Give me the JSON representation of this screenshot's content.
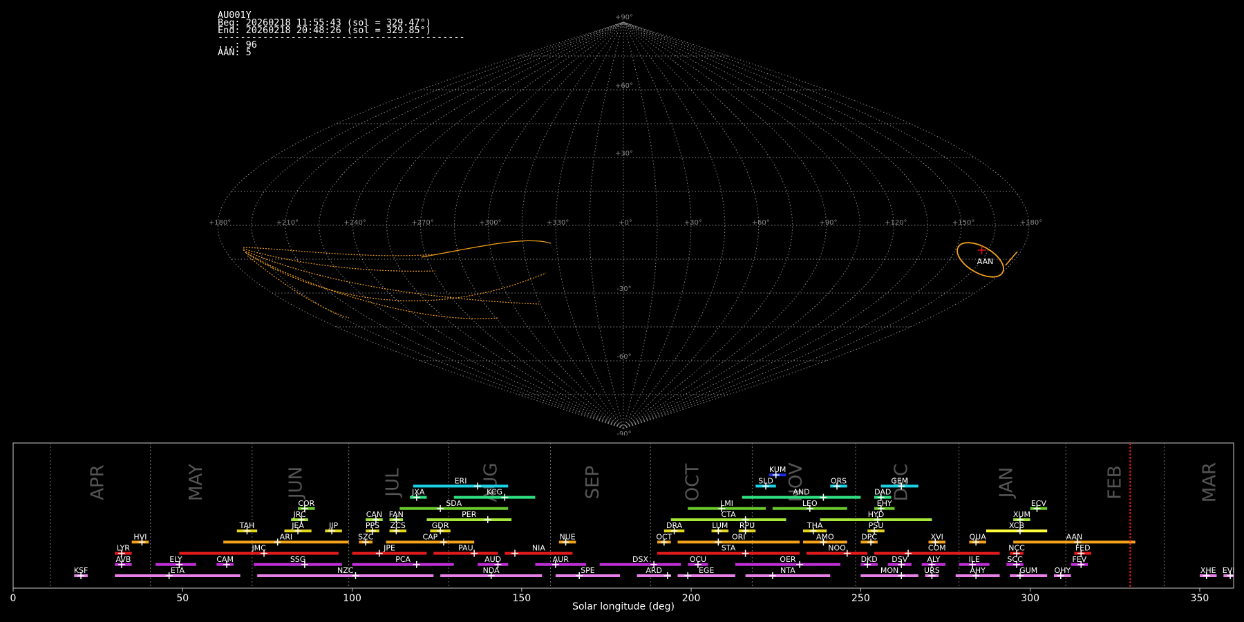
{
  "info": {
    "station": "AU001Y",
    "begin": "Beg: 20260218 11:55:43 (sol = 329.47°)",
    "end": "End: 20260218 20:48:26 (sol = 329.85°)",
    "separator": "--------------------------------------------",
    "sporadic": "...: 96",
    "shower_count": "AAN: 5"
  },
  "sky_map": {
    "projection": "sinusoidal",
    "lon_labels": [
      "+180°",
      "+150°",
      "+120°",
      "+90°",
      "+60°",
      "+30°",
      "+0°",
      "+330°",
      "+300°",
      "+270°",
      "+240°",
      "+210°",
      "+180°"
    ],
    "lat_labels": [
      {
        "lat": 90,
        "label": "+90°"
      },
      {
        "lat": 60,
        "label": "+60°"
      },
      {
        "lat": 30,
        "label": "+30°"
      },
      {
        "lat": -30,
        "label": "-30°"
      },
      {
        "lat": -60,
        "label": "-60°"
      },
      {
        "lat": -90,
        "label": "-90°"
      }
    ],
    "radiant": {
      "code": "AAN",
      "lon": 162,
      "lat": -11
    }
  },
  "chart_data": {
    "type": "timeline",
    "xlabel": "Solar longitude (deg)",
    "xlim": [
      0,
      360
    ],
    "xticks": [
      0,
      50,
      100,
      150,
      200,
      250,
      300,
      350
    ],
    "current_sol": 329.5,
    "month_boundaries": [
      11,
      40.5,
      70.5,
      99,
      128.5,
      158.5,
      188,
      218,
      248.5,
      279,
      310.5,
      339.5
    ],
    "months": [
      {
        "name": "APR",
        "sol": 25
      },
      {
        "name": "MAY",
        "sol": 54
      },
      {
        "name": "JUN",
        "sol": 83.5
      },
      {
        "name": "JUL",
        "sol": 112
      },
      {
        "name": "AUG",
        "sol": 141
      },
      {
        "name": "SEP",
        "sol": 171
      },
      {
        "name": "OCT",
        "sol": 200.5
      },
      {
        "name": "NOV",
        "sol": 231
      },
      {
        "name": "DEC",
        "sol": 262
      },
      {
        "name": "JAN",
        "sol": 293
      },
      {
        "name": "FEB",
        "sol": 325
      },
      {
        "name": "MAR",
        "sol": 353
      }
    ],
    "showers": [
      {
        "code": "KSF",
        "start": 18,
        "end": 22,
        "peak": 20,
        "row": 0,
        "color": "#e67ee6"
      },
      {
        "code": "ETA",
        "start": 30,
        "end": 67,
        "peak": 46,
        "row": 0,
        "color": "#e67ee6"
      },
      {
        "code": "NZC",
        "start": 72,
        "end": 124,
        "peak": 101,
        "row": 0,
        "color": "#e67ee6"
      },
      {
        "code": "NDA",
        "start": 126,
        "end": 156,
        "peak": 141,
        "row": 0,
        "color": "#e67ee6"
      },
      {
        "code": "SPE",
        "start": 160,
        "end": 179,
        "peak": 167,
        "row": 0,
        "color": "#e67ee6"
      },
      {
        "code": "ARD",
        "start": 184,
        "end": 194,
        "peak": 193,
        "row": 0,
        "color": "#e67ee6"
      },
      {
        "code": "EGE",
        "start": 196,
        "end": 213,
        "peak": 199,
        "row": 0,
        "color": "#e67ee6"
      },
      {
        "code": "NTA",
        "start": 216,
        "end": 241,
        "peak": 224,
        "row": 0,
        "color": "#e67ee6"
      },
      {
        "code": "MON",
        "start": 250,
        "end": 267,
        "peak": 262,
        "row": 0,
        "color": "#e67ee6"
      },
      {
        "code": "URS",
        "start": 269,
        "end": 273,
        "peak": 271,
        "row": 0,
        "color": "#e67ee6"
      },
      {
        "code": "AHY",
        "start": 278,
        "end": 291,
        "peak": 284,
        "row": 0,
        "color": "#e67ee6"
      },
      {
        "code": "GUM",
        "start": 294,
        "end": 305,
        "peak": 297,
        "row": 0,
        "color": "#e67ee6"
      },
      {
        "code": "OHY",
        "start": 307,
        "end": 312,
        "peak": 309,
        "row": 0,
        "color": "#e67ee6"
      },
      {
        "code": "XHE",
        "start": 350,
        "end": 355,
        "peak": 352,
        "row": 0,
        "color": "#e67ee6"
      },
      {
        "code": "EVI",
        "start": 357,
        "end": 362,
        "peak": 359,
        "row": 0,
        "color": "#e67ee6"
      },
      {
        "code": "AVB",
        "start": 30,
        "end": 35,
        "peak": 32,
        "row": 1,
        "color": "#c02fd6"
      },
      {
        "code": "ELY",
        "start": 42,
        "end": 54,
        "peak": 49,
        "row": 1,
        "color": "#c02fd6"
      },
      {
        "code": "CAM",
        "start": 60,
        "end": 65,
        "peak": 63,
        "row": 1,
        "color": "#c02fd6"
      },
      {
        "code": "SSG",
        "start": 71,
        "end": 97,
        "peak": 86,
        "row": 1,
        "color": "#c02fd6"
      },
      {
        "code": "PCA",
        "start": 100,
        "end": 130,
        "peak": 119,
        "row": 1,
        "color": "#c02fd6"
      },
      {
        "code": "AUD",
        "start": 137,
        "end": 146,
        "peak": 143,
        "row": 1,
        "color": "#c02fd6"
      },
      {
        "code": "AUR",
        "start": 154,
        "end": 169,
        "peak": 160,
        "row": 1,
        "color": "#c02fd6"
      },
      {
        "code": "DSX",
        "start": 173,
        "end": 197,
        "peak": 189,
        "row": 1,
        "color": "#c02fd6"
      },
      {
        "code": "OCU",
        "start": 199,
        "end": 205,
        "peak": 202,
        "row": 1,
        "color": "#c02fd6"
      },
      {
        "code": "OER",
        "start": 213,
        "end": 244,
        "peak": 232,
        "row": 1,
        "color": "#c02fd6"
      },
      {
        "code": "DKD",
        "start": 250,
        "end": 255,
        "peak": 252,
        "row": 1,
        "color": "#c02fd6"
      },
      {
        "code": "DSV",
        "start": 258,
        "end": 265,
        "peak": 262,
        "row": 1,
        "color": "#c02fd6"
      },
      {
        "code": "ALY",
        "start": 268,
        "end": 275,
        "peak": 271,
        "row": 1,
        "color": "#c02fd6"
      },
      {
        "code": "ILE",
        "start": 279,
        "end": 288,
        "peak": 283,
        "row": 1,
        "color": "#c02fd6"
      },
      {
        "code": "SCC",
        "start": 293,
        "end": 298,
        "peak": 296,
        "row": 1,
        "color": "#c02fd6"
      },
      {
        "code": "FEV",
        "start": 312,
        "end": 317,
        "peak": 315,
        "row": 1,
        "color": "#c02fd6"
      },
      {
        "code": "LYR",
        "start": 30,
        "end": 35,
        "peak": 32,
        "row": 2,
        "color": "#e31a1c"
      },
      {
        "code": "JMC",
        "start": 49,
        "end": 96,
        "peak": 74,
        "row": 2,
        "color": "#e31a1c"
      },
      {
        "code": "JPE",
        "start": 100,
        "end": 122,
        "peak": 108,
        "row": 2,
        "color": "#e31a1c"
      },
      {
        "code": "PAU",
        "start": 124,
        "end": 143,
        "peak": 136,
        "row": 2,
        "color": "#e31a1c"
      },
      {
        "code": "NIA",
        "start": 145,
        "end": 165,
        "peak": 148,
        "row": 2,
        "color": "#e31a1c"
      },
      {
        "code": "STA",
        "start": 190,
        "end": 232,
        "peak": 216,
        "row": 2,
        "color": "#e31a1c"
      },
      {
        "code": "NOO",
        "start": 234,
        "end": 252,
        "peak": 246,
        "row": 2,
        "color": "#e31a1c"
      },
      {
        "code": "COM",
        "start": 254,
        "end": 291,
        "peak": 264,
        "row": 2,
        "color": "#e31a1c"
      },
      {
        "code": "NCC",
        "start": 294,
        "end": 298,
        "peak": 296,
        "row": 2,
        "color": "#e31a1c"
      },
      {
        "code": "FED",
        "start": 313,
        "end": 318,
        "peak": 315,
        "row": 2,
        "color": "#e31a1c"
      },
      {
        "code": "HVI",
        "start": 35,
        "end": 40,
        "peak": 38,
        "row": 3,
        "color": "#f5a21b"
      },
      {
        "code": "ARI",
        "start": 62,
        "end": 99,
        "peak": 78,
        "row": 3,
        "color": "#f5a21b"
      },
      {
        "code": "SZC",
        "start": 102,
        "end": 106,
        "peak": 104,
        "row": 3,
        "color": "#f5a21b"
      },
      {
        "code": "CAP",
        "start": 110,
        "end": 136,
        "peak": 127,
        "row": 3,
        "color": "#f5a21b"
      },
      {
        "code": "NUE",
        "start": 161,
        "end": 166,
        "peak": 163,
        "row": 3,
        "color": "#f5a21b"
      },
      {
        "code": "OCT",
        "start": 190,
        "end": 194,
        "peak": 192,
        "row": 3,
        "color": "#f5a21b"
      },
      {
        "code": "ORI",
        "start": 196,
        "end": 232,
        "peak": 208,
        "row": 3,
        "color": "#f5a21b"
      },
      {
        "code": "AMO",
        "start": 233,
        "end": 246,
        "peak": 239,
        "row": 3,
        "color": "#f5a21b"
      },
      {
        "code": "DPC",
        "start": 250,
        "end": 255,
        "peak": 253,
        "row": 3,
        "color": "#f5a21b"
      },
      {
        "code": "XVI",
        "start": 270,
        "end": 275,
        "peak": 272,
        "row": 3,
        "color": "#f5a21b"
      },
      {
        "code": "QUA",
        "start": 282,
        "end": 287,
        "peak": 284,
        "row": 3,
        "color": "#f5a21b"
      },
      {
        "code": "AAN",
        "start": 295,
        "end": 331,
        "peak": 314,
        "row": 3,
        "color": "#f5a21b"
      },
      {
        "code": "TAH",
        "start": 66,
        "end": 72,
        "peak": 69,
        "row": 4,
        "color": "#e3d61c"
      },
      {
        "code": "JEA",
        "start": 80,
        "end": 88,
        "peak": 84,
        "row": 4,
        "color": "#e3d61c"
      },
      {
        "code": "JIP",
        "start": 92,
        "end": 97,
        "peak": 94,
        "row": 4,
        "color": "#e3d61c"
      },
      {
        "code": "PPS",
        "start": 104,
        "end": 108,
        "peak": 106,
        "row": 4,
        "color": "#e3d61c"
      },
      {
        "code": "ZCS",
        "start": 111,
        "end": 116,
        "peak": 113,
        "row": 4,
        "color": "#e3d61c"
      },
      {
        "code": "GDR",
        "start": 123,
        "end": 129,
        "peak": 126,
        "row": 4,
        "color": "#e3d61c"
      },
      {
        "code": "DRA",
        "start": 192,
        "end": 198,
        "peak": 195,
        "row": 4,
        "color": "#e3d61c"
      },
      {
        "code": "LUM",
        "start": 206,
        "end": 211,
        "peak": 208,
        "row": 4,
        "color": "#e3d61c"
      },
      {
        "code": "RPU",
        "start": 214,
        "end": 219,
        "peak": 216,
        "row": 4,
        "color": "#e3d61c"
      },
      {
        "code": "THA",
        "start": 233,
        "end": 240,
        "peak": 236,
        "row": 4,
        "color": "#e3d61c"
      },
      {
        "code": "PSU",
        "start": 252,
        "end": 257,
        "peak": 254,
        "row": 4,
        "color": "#e3d61c"
      },
      {
        "code": "XCB",
        "start": 287,
        "end": 305,
        "peak": 297,
        "row": 4,
        "color": "#ffff3c"
      },
      {
        "code": "JRC",
        "start": 82,
        "end": 87,
        "peak": 85,
        "row": 5,
        "color": "#a6e83a"
      },
      {
        "code": "CAN",
        "start": 104,
        "end": 109,
        "peak": 107,
        "row": 5,
        "color": "#a6e83a"
      },
      {
        "code": "FAN",
        "start": 111,
        "end": 115,
        "peak": 113,
        "row": 5,
        "color": "#a6e83a"
      },
      {
        "code": "PER",
        "start": 122,
        "end": 147,
        "peak": 140,
        "row": 5,
        "color": "#a6e83a"
      },
      {
        "code": "CTA",
        "start": 194,
        "end": 228,
        "peak": 216,
        "row": 5,
        "color": "#a6e83a"
      },
      {
        "code": "HYD",
        "start": 238,
        "end": 271,
        "peak": 255,
        "row": 5,
        "color": "#a6e83a"
      },
      {
        "code": "XUM",
        "start": 295,
        "end": 300,
        "peak": 297,
        "row": 5,
        "color": "#a6e83a"
      },
      {
        "code": "COR",
        "start": 84,
        "end": 89,
        "peak": 86,
        "row": 6,
        "color": "#6ac92d"
      },
      {
        "code": "SDA",
        "start": 114,
        "end": 146,
        "peak": 126,
        "row": 6,
        "color": "#6ac92d"
      },
      {
        "code": "LMI",
        "start": 199,
        "end": 222,
        "peak": 209,
        "row": 6,
        "color": "#6ac92d"
      },
      {
        "code": "LEO",
        "start": 224,
        "end": 246,
        "peak": 235,
        "row": 6,
        "color": "#6ac92d"
      },
      {
        "code": "EHY",
        "start": 254,
        "end": 260,
        "peak": 256,
        "row": 6,
        "color": "#6ac92d"
      },
      {
        "code": "ECV",
        "start": 300,
        "end": 305,
        "peak": 302,
        "row": 6,
        "color": "#6ac92d"
      },
      {
        "code": "JXA",
        "start": 117,
        "end": 122,
        "peak": 119,
        "row": 7,
        "color": "#2ee07f"
      },
      {
        "code": "KCG",
        "start": 130,
        "end": 154,
        "peak": 145,
        "row": 7,
        "color": "#2ee07f"
      },
      {
        "code": "AND",
        "start": 215,
        "end": 250,
        "peak": 239,
        "row": 7,
        "color": "#2ee07f"
      },
      {
        "code": "DAD",
        "start": 254,
        "end": 259,
        "peak": 256,
        "row": 7,
        "color": "#2ee07f"
      },
      {
        "code": "ERI",
        "start": 118,
        "end": 146,
        "peak": 137,
        "row": 8,
        "color": "#1ad2e6"
      },
      {
        "code": "SLD",
        "start": 219,
        "end": 225,
        "peak": 222,
        "row": 8,
        "color": "#1ad2e6"
      },
      {
        "code": "ORS",
        "start": 241,
        "end": 246,
        "peak": 243,
        "row": 8,
        "color": "#1ad2e6"
      },
      {
        "code": "GEM",
        "start": 256,
        "end": 267,
        "peak": 262,
        "row": 8,
        "color": "#1ad2e6"
      },
      {
        "code": "KUM",
        "start": 223,
        "end": 228,
        "peak": 225,
        "row": 9,
        "color": "#1a2de6"
      }
    ]
  }
}
